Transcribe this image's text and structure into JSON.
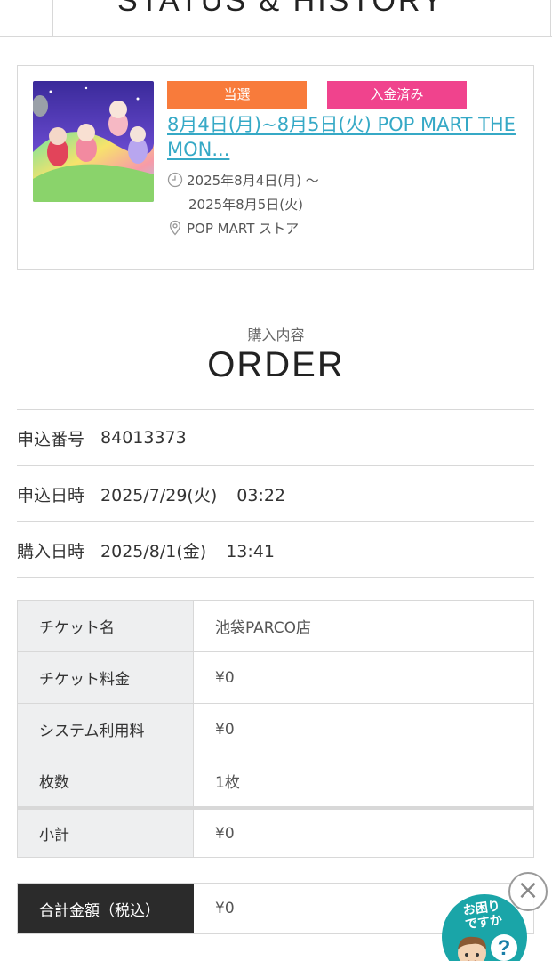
{
  "header": {
    "title": "STATUS & HISTORY"
  },
  "event": {
    "badge_won": "当選",
    "badge_paid": "入金済み",
    "title": "8月4日(月)~8月5日(火) POP MART THE MON...",
    "date_line1": "2025年8月4日(月) 〜",
    "date_line2": "2025年8月5日(火)",
    "place": "POP MART ストア",
    "icons": {
      "date": "clock-icon",
      "place": "map-pin-icon"
    },
    "colors": {
      "won": "#f87b3b",
      "paid": "#f0438d",
      "link": "#36a9c6"
    }
  },
  "order": {
    "subtitle": "購入内容",
    "title": "ORDER",
    "application_number_label": "申込番号",
    "application_number": "84013373",
    "application_datetime_label": "申込日時",
    "application_date": "2025/7/29(火)",
    "application_time": "03:22",
    "purchase_datetime_label": "購入日時",
    "purchase_date": "2025/8/1(金)",
    "purchase_time": "13:41"
  },
  "tickets": {
    "name_label": "チケット名",
    "name": "池袋PARCO店",
    "price_label": "チケット料金",
    "price": "¥0",
    "system_fee_label": "システム利用料",
    "system_fee": "¥0",
    "count_label": "枚数",
    "count": "1枚",
    "subtotal_label": "小計",
    "subtotal": "¥0",
    "total_label": "合計金額（税込）",
    "total": "¥0"
  },
  "help": {
    "text_line1": "お困り",
    "text_line2": "ですか",
    "close_symbol": "×",
    "question_symbol": "?",
    "color": "#1aa5a8"
  }
}
